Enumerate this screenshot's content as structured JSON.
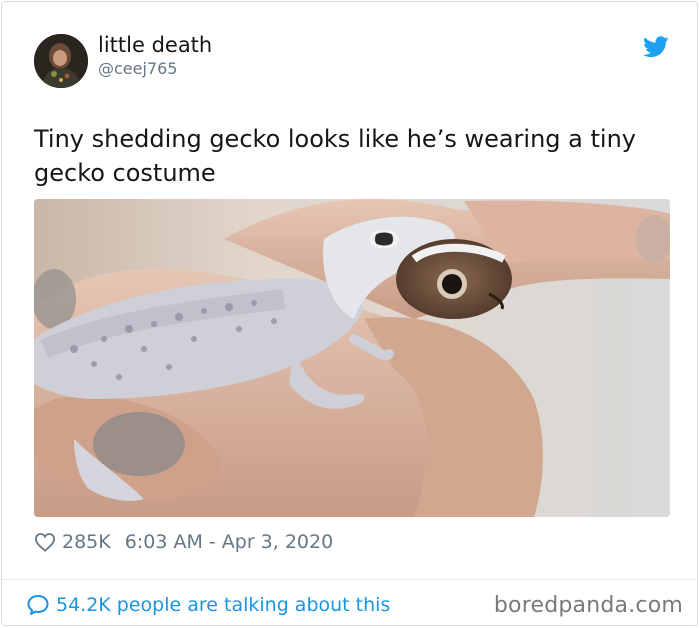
{
  "tweet": {
    "author": {
      "display_name": "little death",
      "handle": "@ceej765"
    },
    "text": "Tiny shedding gecko looks like he’s wearing a tiny gecko costume",
    "likes": "285K",
    "timestamp": "6:03 AM - Apr 3, 2020",
    "icons": {
      "brand": "twitter-bird-icon",
      "like": "heart-icon",
      "replies": "speech-bubble-icon"
    },
    "colors": {
      "brand_blue": "#1da1f2",
      "link_blue": "#1b95e0",
      "muted": "#657786"
    }
  },
  "footer": {
    "talking": "54.2K people are talking about this",
    "watermark": "boredpanda.com"
  }
}
